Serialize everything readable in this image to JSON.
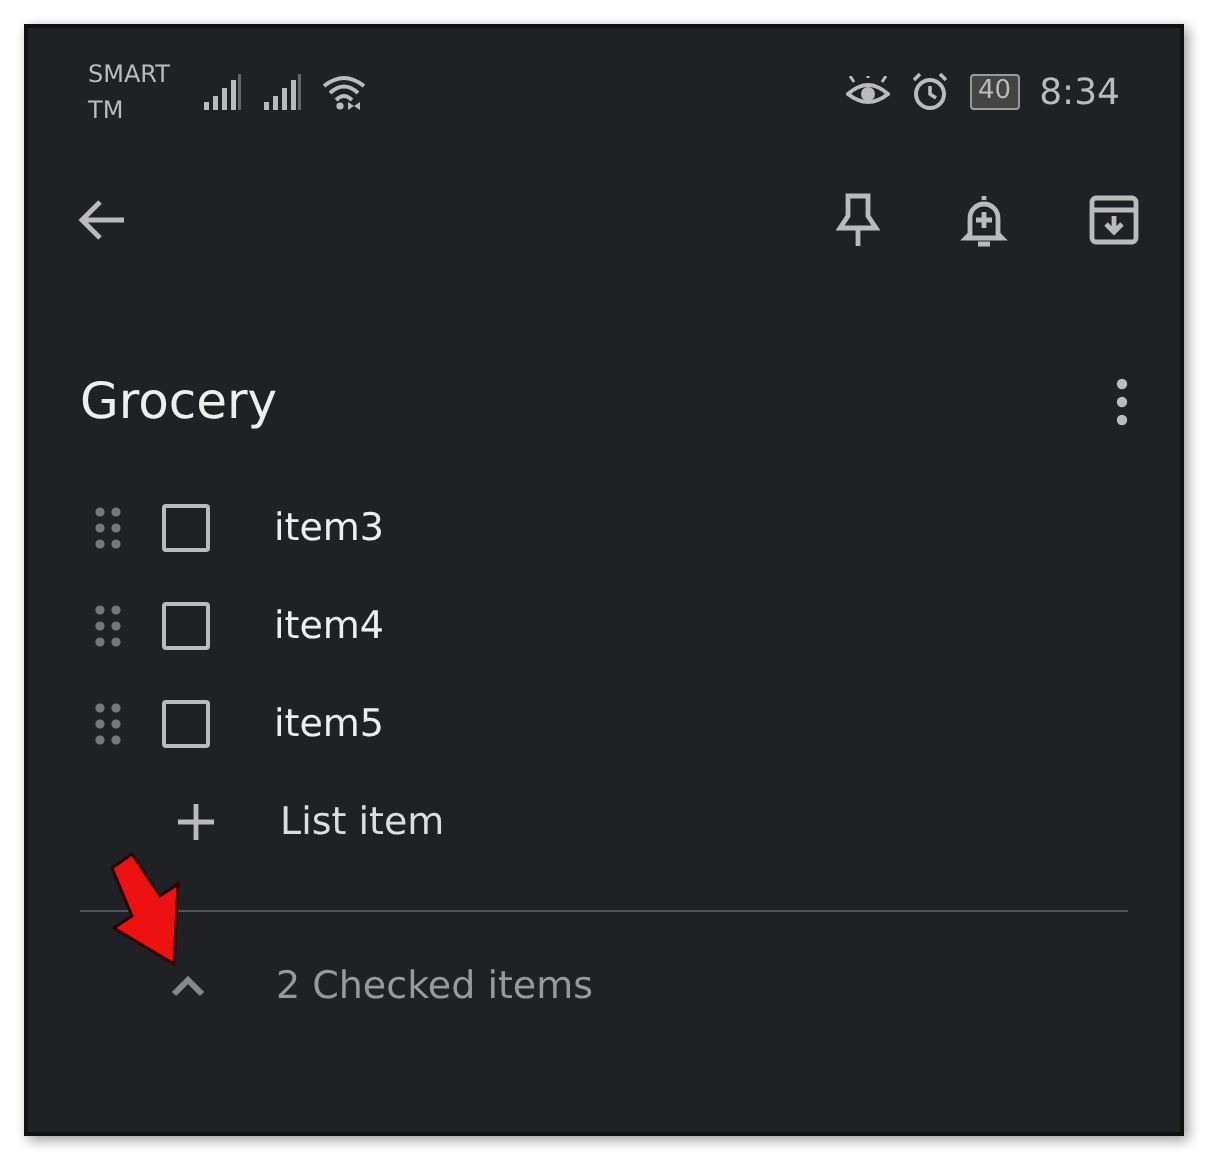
{
  "status_bar": {
    "carrier": [
      "SMART",
      "TM"
    ],
    "battery": "40",
    "time": "8:34"
  },
  "note": {
    "title": "Grocery",
    "items": [
      {
        "text": "item3",
        "checked": false
      },
      {
        "text": "item4",
        "checked": false
      },
      {
        "text": "item5",
        "checked": false
      }
    ],
    "add_item": {
      "placeholder": "List item"
    },
    "checked_section": {
      "label": "2 Checked items",
      "expanded": false
    }
  }
}
